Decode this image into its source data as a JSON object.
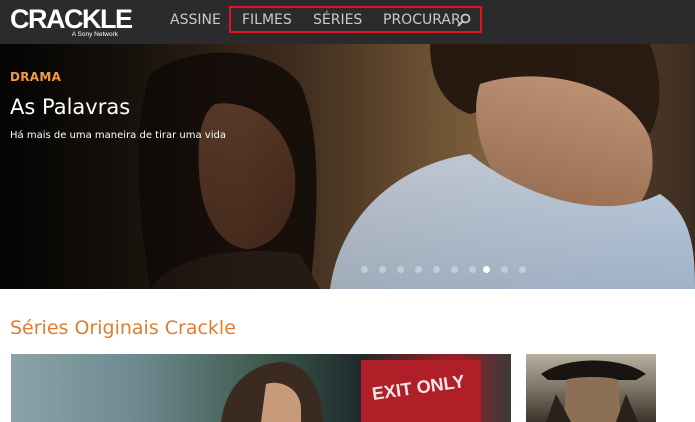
{
  "nav": {
    "logo_text": "CRACKLE",
    "logo_sub": "A Sony Network",
    "links": [
      {
        "label": "ASSINE"
      },
      {
        "label": "FILMES"
      },
      {
        "label": "SÉRIES"
      },
      {
        "label": "PROCURAR"
      }
    ],
    "highlight_color": "#e0141b"
  },
  "hero": {
    "genre": "DRAMA",
    "title": "As Palavras",
    "tagline": "Há mais de uma maneira de tirar uma vida",
    "genre_color": "#f19c40",
    "dots_total": 10,
    "active_dot": 8
  },
  "section": {
    "title": "Séries Originais Crackle",
    "title_color": "#e27c2e",
    "cards": [
      {
        "overlay_text": "EXIT ONLY"
      },
      {}
    ]
  }
}
